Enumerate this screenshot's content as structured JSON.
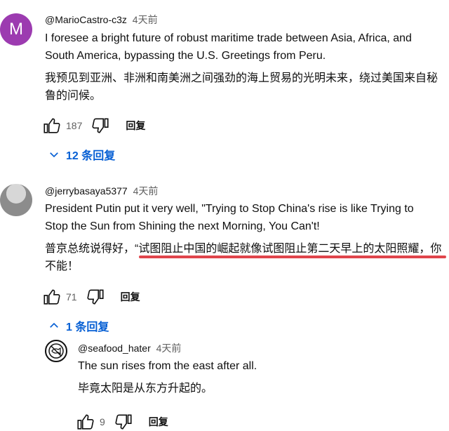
{
  "comments": [
    {
      "avatar_letter": "M",
      "handle": "@MarioCastro-c3z",
      "time": "4天前",
      "text_en": "I foresee a bright future of robust maritime trade between Asia, Africa, and South America, bypassing the U.S. Greetings from Peru.",
      "text_zh": "我预见到亚洲、非洲和南美洲之间强劲的海上贸易的光明未来，绕过美国来自秘鲁的问候。",
      "likes": "187",
      "reply_label": "回复",
      "replies_label": "12 条回复"
    },
    {
      "handle": "@jerrybasaya5377",
      "time": "4天前",
      "text_en": "President Putin put it very well, \"Trying to Stop China's rise is like Trying to Stop the Sun from Shining the next Morning, You Can't!",
      "text_zh": "普京总统说得好，“试图阻止中国的崛起就像试图阻止第二天早上的太阳照耀，你不能！",
      "likes": "71",
      "reply_label": "回复",
      "replies_label": "1 条回复"
    }
  ],
  "reply": {
    "handle": "@seafood_hater",
    "time": "4天前",
    "text_en": "The sun rises from the east after all.",
    "text_zh": "毕竟太阳是从东方升起的。",
    "likes": "9",
    "reply_label": "回复"
  },
  "colors": {
    "link_blue": "#065fd4",
    "highlight_red": "#e0454b",
    "avatar_purple": "#9c3bb0"
  }
}
